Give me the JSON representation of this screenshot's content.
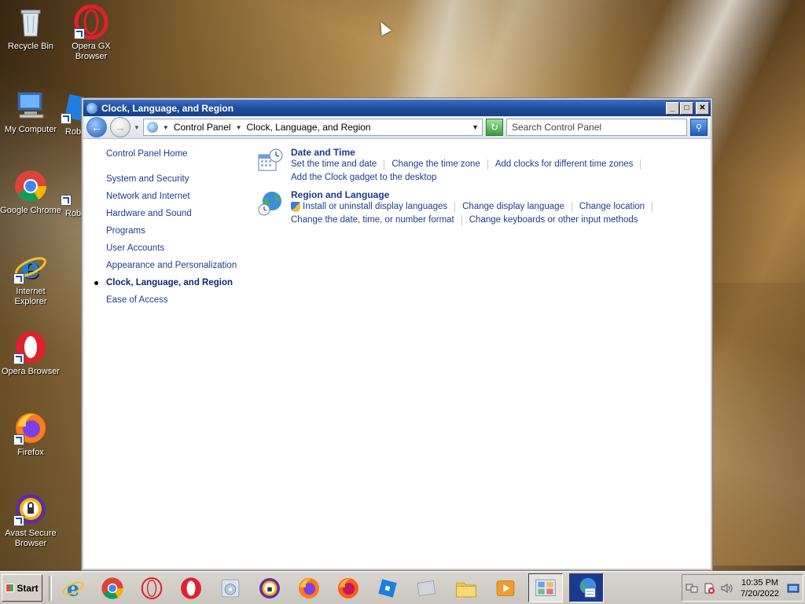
{
  "desktop": {
    "icons": [
      {
        "name": "recycle-bin",
        "label": "Recycle Bin"
      },
      {
        "name": "opera-gx-browser",
        "label": "Opera GX Browser"
      },
      {
        "name": "my-computer",
        "label": "My Computer"
      },
      {
        "name": "google-chrome",
        "label": "Google Chrome"
      },
      {
        "name": "internet-explorer",
        "label": "Internet Explorer"
      },
      {
        "name": "opera-browser",
        "label": "Opera Browser"
      },
      {
        "name": "firefox",
        "label": "Firefox"
      },
      {
        "name": "avast-secure-browser",
        "label": "Avast Secure Browser"
      },
      {
        "name": "roblox-partial-1",
        "label": "Robl"
      },
      {
        "name": "roblox-partial-2",
        "label": "Robl"
      }
    ]
  },
  "window": {
    "title": "Clock, Language, and Region",
    "buttons": {
      "minimize": "_",
      "maximize": "□",
      "close": "✕"
    },
    "address": {
      "crumbs": [
        "Control Panel",
        "Clock, Language, and Region"
      ]
    },
    "search": {
      "placeholder": "Search Control Panel"
    }
  },
  "leftnav": {
    "home": "Control Panel Home",
    "items": [
      "System and Security",
      "Network and Internet",
      "Hardware and Sound",
      "Programs",
      "User Accounts",
      "Appearance and Personalization",
      "Clock, Language, and Region",
      "Ease of Access"
    ],
    "active_index": 6
  },
  "sections": [
    {
      "title": "Date and Time",
      "icon": "clock-calendar-icon",
      "links": [
        "Set the time and date",
        "Change the time zone",
        "Add clocks for different time zones",
        "Add the Clock gadget to the desktop"
      ]
    },
    {
      "title": "Region and Language",
      "icon": "globe-clock-icon",
      "links": [
        "Install or uninstall display languages",
        "Change display language",
        "Change location",
        "Change the date, time, or number format",
        "Change keyboards or other input methods"
      ]
    }
  ],
  "taskbar": {
    "start_label": "Start",
    "items": [
      "internet-explorer",
      "google-chrome",
      "opera-gx",
      "opera",
      "media-player",
      "avast-secure-browser",
      "firefox",
      "firefox-alt",
      "roblox",
      "flat-app",
      "folder",
      "media-player-classic",
      "control-panel",
      "clock-language-region"
    ],
    "clock": {
      "time": "10:35 PM",
      "date": "7/20/2022"
    }
  }
}
